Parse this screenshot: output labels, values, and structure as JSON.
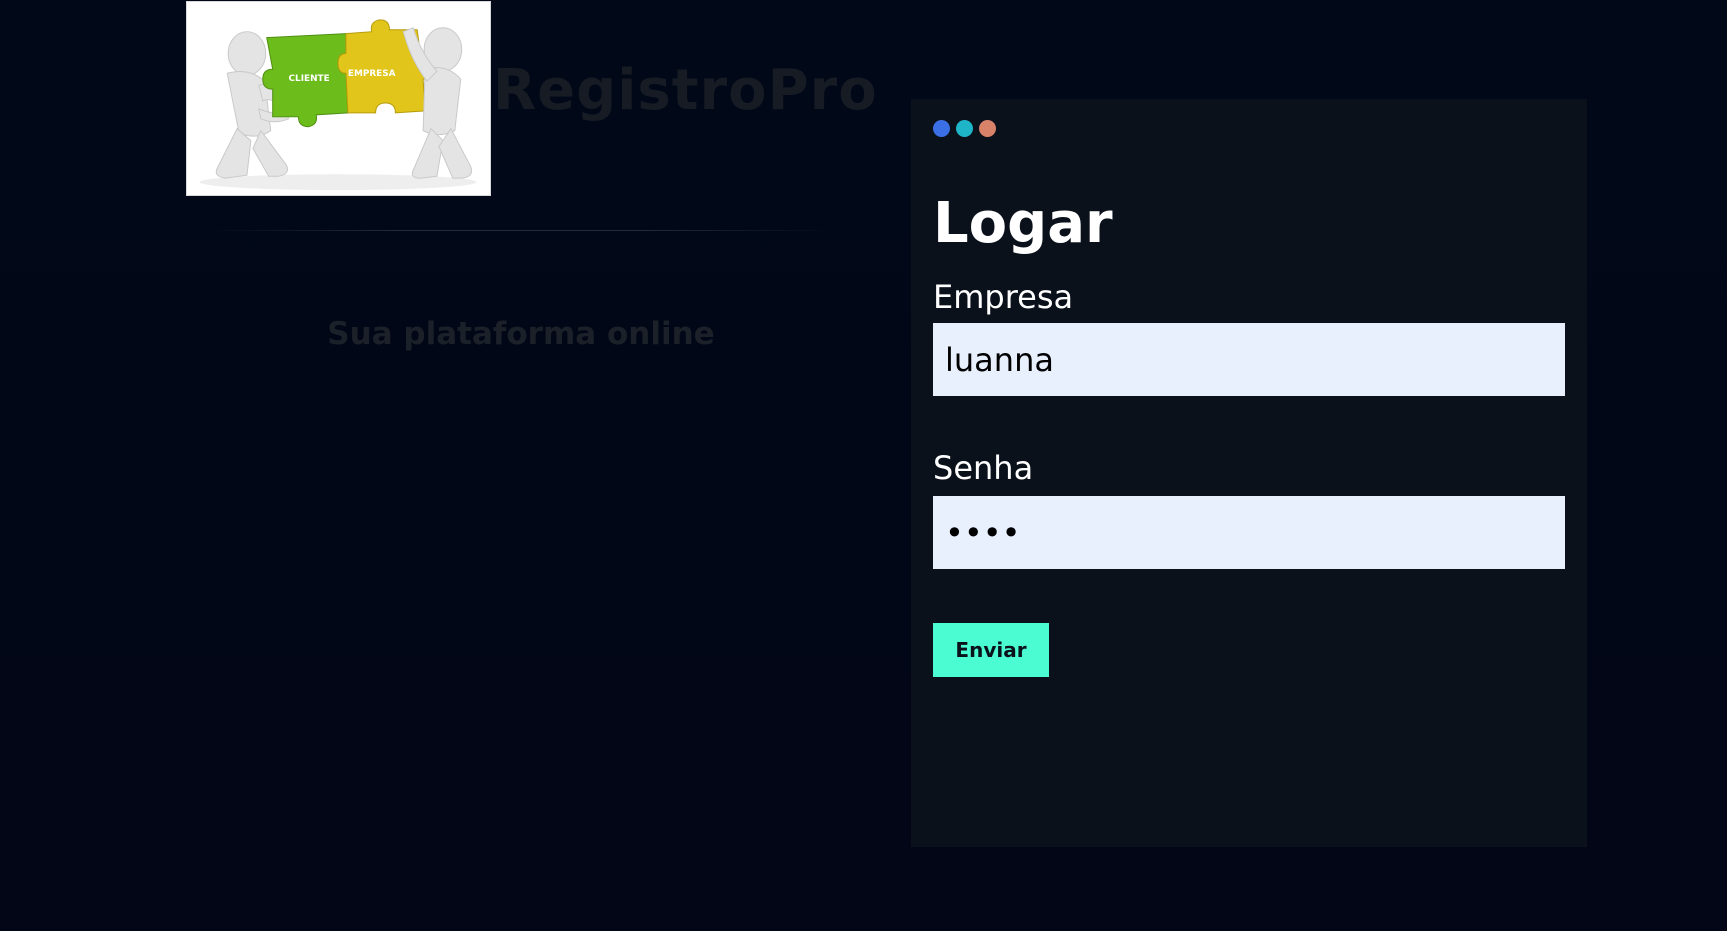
{
  "brand": {
    "title": "RegistroPro",
    "tagline": "Sua plataforma online",
    "logo": {
      "left_piece_label": "CLIENTE",
      "right_piece_label": "EMPRESA"
    }
  },
  "login": {
    "title": "Logar",
    "company_label": "Empresa",
    "company_value": "luanna",
    "password_label": "Senha",
    "password_value": "1234",
    "submit_label": "Enviar"
  },
  "colors": {
    "page_background": "#020617",
    "card_background": "#0b111b",
    "input_background": "#e8f0fe",
    "accent": "#4bfcd2",
    "dot_blue": "#3b6fe5",
    "dot_cyan": "#1fb5c9",
    "dot_orange": "#d9826a"
  },
  "icons": [
    "window-dots-icon",
    "puzzle-logo-icon"
  ]
}
